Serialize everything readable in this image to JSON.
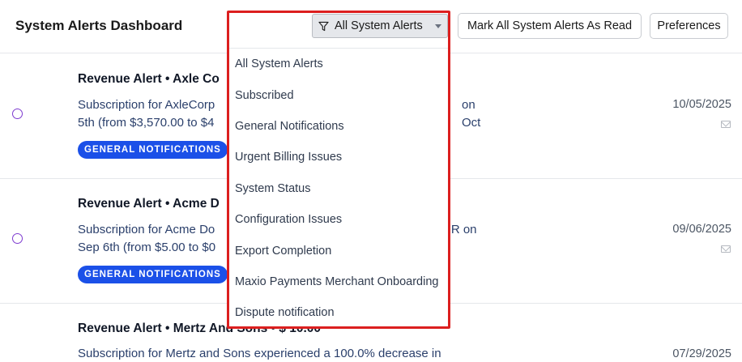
{
  "header": {
    "title": "System Alerts Dashboard",
    "filter_label": "All System Alerts",
    "mark_all_label": "Mark All System Alerts As Read",
    "preferences_label": "Preferences"
  },
  "alerts": [
    {
      "title": "Revenue Alert • Axle Co",
      "description": "Subscription for AxleCorp",
      "description_tail": "on Oct",
      "description_line2": "5th (from $3,570.00 to $4",
      "badge": "GENERAL NOTIFICATIONS",
      "date": "10/05/2025"
    },
    {
      "title": "Revenue Alert • Acme D",
      "description": "Subscription for Acme Do",
      "description_tail": "RR on",
      "description_line2": "Sep 6th (from $5.00 to $0",
      "badge": "GENERAL NOTIFICATIONS",
      "date": "09/06/2025"
    },
    {
      "title": "Revenue Alert • Mertz And Sons • $ 10.00",
      "description": "Subscription for Mertz and Sons experienced a 100.0% decrease in",
      "date": "07/29/2025"
    }
  ],
  "dropdown": {
    "items": [
      "All System Alerts",
      "Subscribed",
      "General Notifications",
      "Urgent Billing Issues",
      "System Status",
      "Configuration Issues",
      "Export Completion",
      "Maxio Payments Merchant Onboarding",
      "Dispute notification"
    ]
  },
  "colors": {
    "badge": "#1b50e8",
    "unread_dot": "#7e3bd0",
    "dropdown_highlight": "#dc1f1f"
  }
}
